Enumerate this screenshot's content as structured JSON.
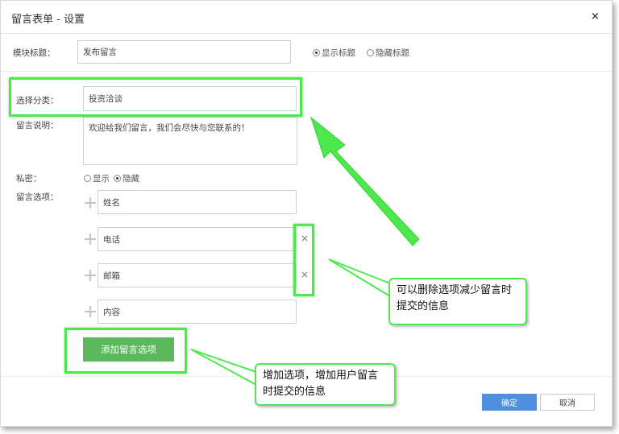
{
  "dialog": {
    "title": "留言表单 - 设置",
    "close_label": "×"
  },
  "module_title": {
    "label": "模块标题：",
    "value": "发布留言",
    "options": [
      {
        "label": "显示标题",
        "selected": true
      },
      {
        "label": "隐藏标题",
        "selected": false
      }
    ]
  },
  "category": {
    "label": "选择分类：",
    "value": "投资洽谈"
  },
  "description": {
    "label": "留言说明：",
    "value": "欢迎给我们留言，我们会尽快与您联系的！"
  },
  "privacy": {
    "label": "私密：",
    "options": [
      {
        "label": "显示",
        "selected": false
      },
      {
        "label": "隐藏",
        "selected": true
      }
    ]
  },
  "fields": {
    "label": "留言选项：",
    "items": [
      {
        "value": "姓名",
        "deletable": false
      },
      {
        "value": "电话",
        "deletable": true,
        "delete_label": "×"
      },
      {
        "value": "邮箱",
        "deletable": true,
        "delete_label": "×"
      },
      {
        "value": "内容",
        "deletable": false
      }
    ],
    "add_button": "添加留言选项"
  },
  "callouts": {
    "delete_tip": "可以删除选项减少留言时提交的信息",
    "add_tip": "增加选项，增加用户留言时提交的信息"
  },
  "footer": {
    "ok": "确定",
    "cancel": "取消"
  },
  "colors": {
    "highlight": "#4ce84c",
    "primary": "#4f8fe0",
    "add_button": "#5cb85c"
  }
}
